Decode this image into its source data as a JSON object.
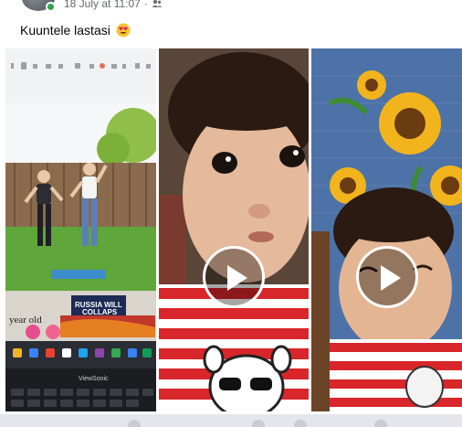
{
  "post": {
    "timestamp": "18 July at 11:07",
    "separator": "·",
    "audience_icon": "friends-icon",
    "caption": "Kuuntele lastasi",
    "caption_emoji": "heart-eyes-emoji"
  },
  "media": {
    "tiles": [
      {
        "kind": "image",
        "overlay_text_1": "year old",
        "overlay_text_2": "RUSSIA WILL",
        "overlay_text_3": "COLLAPS",
        "monitor_brand": "ViewSonic"
      },
      {
        "kind": "video",
        "play_icon": "play-icon"
      },
      {
        "kind": "video",
        "play_icon": "play-icon"
      }
    ]
  },
  "colors": {
    "accent_online": "#31a24c",
    "meta_text": "#65676b",
    "stripe_red": "#d8262b"
  }
}
